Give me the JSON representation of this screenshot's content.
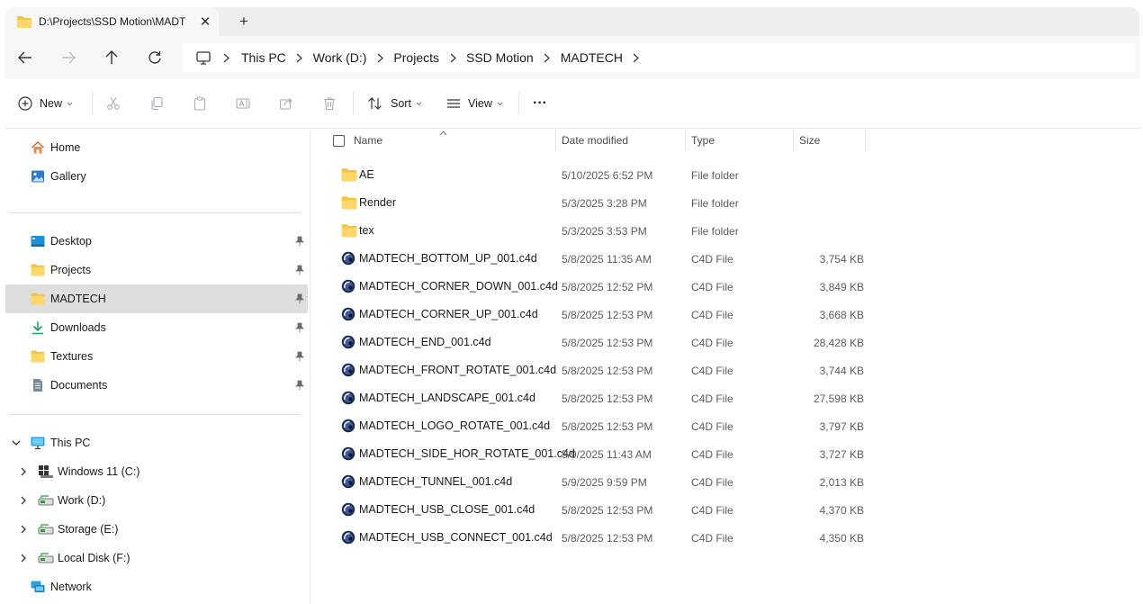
{
  "tab": {
    "title": "D:\\Projects\\SSD Motion\\MADTECH",
    "close": "✕",
    "new": "+"
  },
  "breadcrumb": [
    "This PC",
    "Work (D:)",
    "Projects",
    "SSD Motion",
    "MADTECH"
  ],
  "toolbar": {
    "new_label": "New",
    "sort_label": "Sort",
    "view_label": "View",
    "more_label": "···"
  },
  "sidebar": {
    "top": [
      {
        "label": "Home",
        "icon": "home-icon"
      },
      {
        "label": "Gallery",
        "icon": "gallery-icon"
      }
    ],
    "quick": [
      {
        "label": "Desktop",
        "icon": "desktop-icon"
      },
      {
        "label": "Projects",
        "icon": "folder-icon"
      },
      {
        "label": "MADTECH",
        "icon": "folder-icon",
        "selected": true
      },
      {
        "label": "Downloads",
        "icon": "download-icon"
      },
      {
        "label": "Textures",
        "icon": "folder-icon"
      },
      {
        "label": "Documents",
        "icon": "documents-icon"
      }
    ],
    "this_pc": "This PC",
    "drives": [
      "Windows 11 (C:)",
      "Work (D:)",
      "Storage (E:)",
      "Local Disk (F:)"
    ],
    "network": "Network"
  },
  "columns": {
    "name": "Name",
    "date": "Date modified",
    "type": "Type",
    "size": "Size"
  },
  "files": [
    {
      "name": "AE",
      "date": "5/10/2025 6:52 PM",
      "type": "File folder",
      "size": "",
      "kind": "folder"
    },
    {
      "name": "Render",
      "date": "5/3/2025 3:28 PM",
      "type": "File folder",
      "size": "",
      "kind": "folder"
    },
    {
      "name": "tex",
      "date": "5/3/2025 3:53 PM",
      "type": "File folder",
      "size": "",
      "kind": "folder"
    },
    {
      "name": "MADTECH_BOTTOM_UP_001.c4d",
      "date": "5/8/2025 11:35 AM",
      "type": "C4D File",
      "size": "3,754 KB",
      "kind": "c4d"
    },
    {
      "name": "MADTECH_CORNER_DOWN_001.c4d",
      "date": "5/8/2025 12:52 PM",
      "type": "C4D File",
      "size": "3,849 KB",
      "kind": "c4d"
    },
    {
      "name": "MADTECH_CORNER_UP_001.c4d",
      "date": "5/8/2025 12:53 PM",
      "type": "C4D File",
      "size": "3,668 KB",
      "kind": "c4d"
    },
    {
      "name": "MADTECH_END_001.c4d",
      "date": "5/8/2025 12:53 PM",
      "type": "C4D File",
      "size": "28,428 KB",
      "kind": "c4d"
    },
    {
      "name": "MADTECH_FRONT_ROTATE_001.c4d",
      "date": "5/8/2025 12:53 PM",
      "type": "C4D File",
      "size": "3,744 KB",
      "kind": "c4d"
    },
    {
      "name": "MADTECH_LANDSCAPE_001.c4d",
      "date": "5/8/2025 12:53 PM",
      "type": "C4D File",
      "size": "27,598 KB",
      "kind": "c4d"
    },
    {
      "name": "MADTECH_LOGO_ROTATE_001.c4d",
      "date": "5/8/2025 12:53 PM",
      "type": "C4D File",
      "size": "3,797 KB",
      "kind": "c4d"
    },
    {
      "name": "MADTECH_SIDE_HOR_ROTATE_001.c4d",
      "date": "5/9/2025 11:43 AM",
      "type": "C4D File",
      "size": "3,727 KB",
      "kind": "c4d"
    },
    {
      "name": "MADTECH_TUNNEL_001.c4d",
      "date": "5/9/2025 9:59 PM",
      "type": "C4D File",
      "size": "2,013 KB",
      "kind": "c4d"
    },
    {
      "name": "MADTECH_USB_CLOSE_001.c4d",
      "date": "5/8/2025 12:53 PM",
      "type": "C4D File",
      "size": "4,370 KB",
      "kind": "c4d"
    },
    {
      "name": "MADTECH_USB_CONNECT_001.c4d",
      "date": "5/8/2025 12:53 PM",
      "type": "C4D File",
      "size": "4,350 KB",
      "kind": "c4d"
    }
  ],
  "colors": {
    "folder": "#f5c242",
    "selected_bg": "#dedede",
    "titlebar": "#eeeeee"
  }
}
